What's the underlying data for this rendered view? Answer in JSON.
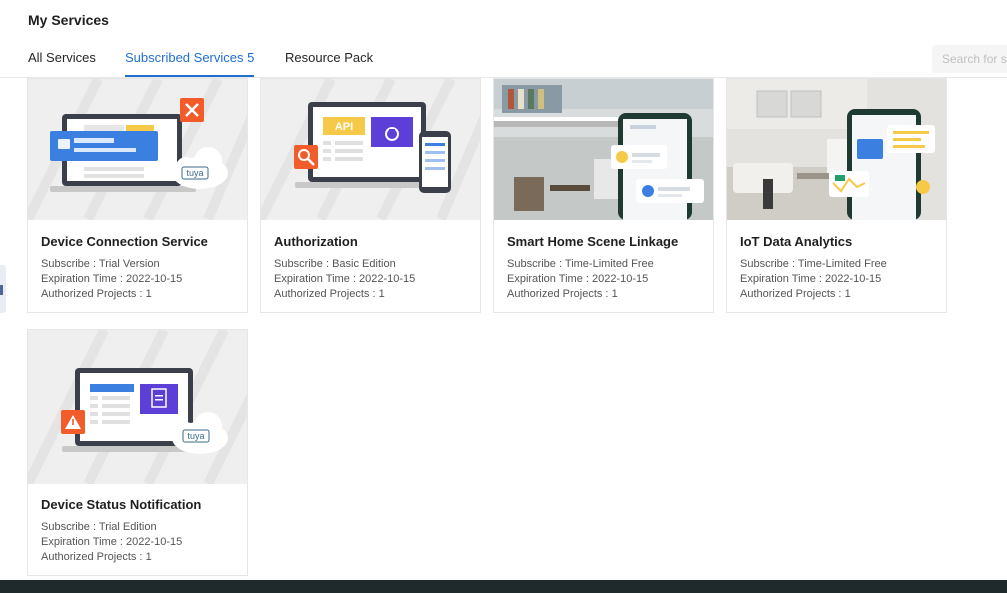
{
  "header": {
    "title": "My Services"
  },
  "tabs": [
    {
      "label": "All Services"
    },
    {
      "label": "Subscribed Services 5"
    },
    {
      "label": "Resource Pack"
    }
  ],
  "search": {
    "placeholder": "Search for se"
  },
  "labels": {
    "subscribe": "Subscribe : ",
    "expiration": "Expiration Time : ",
    "projects": "Authorized Projects : "
  },
  "cards": [
    {
      "title": "Device Connection Service",
      "subscribe": "Trial Version",
      "expiration": "2022-10-15",
      "projects": "1",
      "logo": "tuya"
    },
    {
      "title": "Authorization",
      "subscribe": "Basic Edition",
      "expiration": "2022-10-15",
      "projects": "1",
      "api": "API"
    },
    {
      "title": "Smart Home Scene Linkage",
      "subscribe": "Time-Limited Free",
      "expiration": "2022-10-15",
      "projects": "1"
    },
    {
      "title": "IoT Data Analytics",
      "subscribe": "Time-Limited Free",
      "expiration": "2022-10-15",
      "projects": "1"
    },
    {
      "title": "Device Status Notification",
      "subscribe": "Trial Edition",
      "expiration": "2022-10-15",
      "projects": "1",
      "logo": "tuya"
    }
  ],
  "colors": {
    "accent": "#1f6fd1",
    "orange": "#f25c2a",
    "purple": "#5b3fd6",
    "yellow": "#f7c948"
  }
}
